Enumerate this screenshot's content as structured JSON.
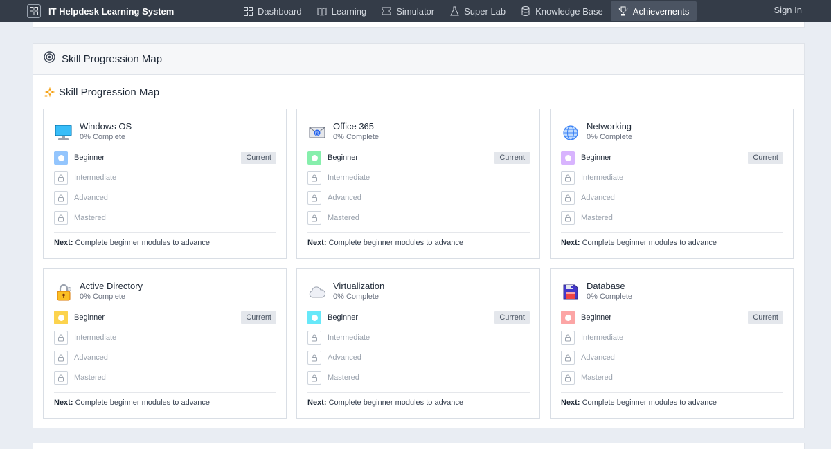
{
  "app": {
    "title": "IT Helpdesk Learning System",
    "sign_in": "Sign In"
  },
  "nav": [
    {
      "label": "Dashboard",
      "icon": "grid-icon",
      "active": false
    },
    {
      "label": "Learning",
      "icon": "book-icon",
      "active": false
    },
    {
      "label": "Simulator",
      "icon": "ticket-icon",
      "active": false
    },
    {
      "label": "Super Lab",
      "icon": "flask-icon",
      "active": false
    },
    {
      "label": "Knowledge Base",
      "icon": "database-icon",
      "active": false
    },
    {
      "label": "Achievements",
      "icon": "trophy-icon",
      "active": true
    }
  ],
  "panel": {
    "header_title": "Skill Progression Map",
    "section_title": "Skill Progression Map"
  },
  "skills": [
    {
      "name": "Windows OS",
      "progress": "0% Complete",
      "icon": "monitor-icon",
      "color": "#93c5fd"
    },
    {
      "name": "Office 365",
      "progress": "0% Complete",
      "icon": "envelope-icon",
      "color": "#86efac"
    },
    {
      "name": "Networking",
      "progress": "0% Complete",
      "icon": "globe-icon",
      "color": "#d8b4fe"
    },
    {
      "name": "Active Directory",
      "progress": "0% Complete",
      "icon": "padlock-icon",
      "color": "#fcd34d"
    },
    {
      "name": "Virtualization",
      "progress": "0% Complete",
      "icon": "cloud-icon",
      "color": "#67e8f9"
    },
    {
      "name": "Database",
      "progress": "0% Complete",
      "icon": "floppy-disk-icon",
      "color": "#fca5a5"
    }
  ],
  "levels": {
    "beginner": "Beginner",
    "intermediate": "Intermediate",
    "advanced": "Advanced",
    "mastered": "Mastered"
  },
  "current_badge": "Current",
  "next_label": "Next:",
  "next_text": "Complete beginner modules to advance"
}
